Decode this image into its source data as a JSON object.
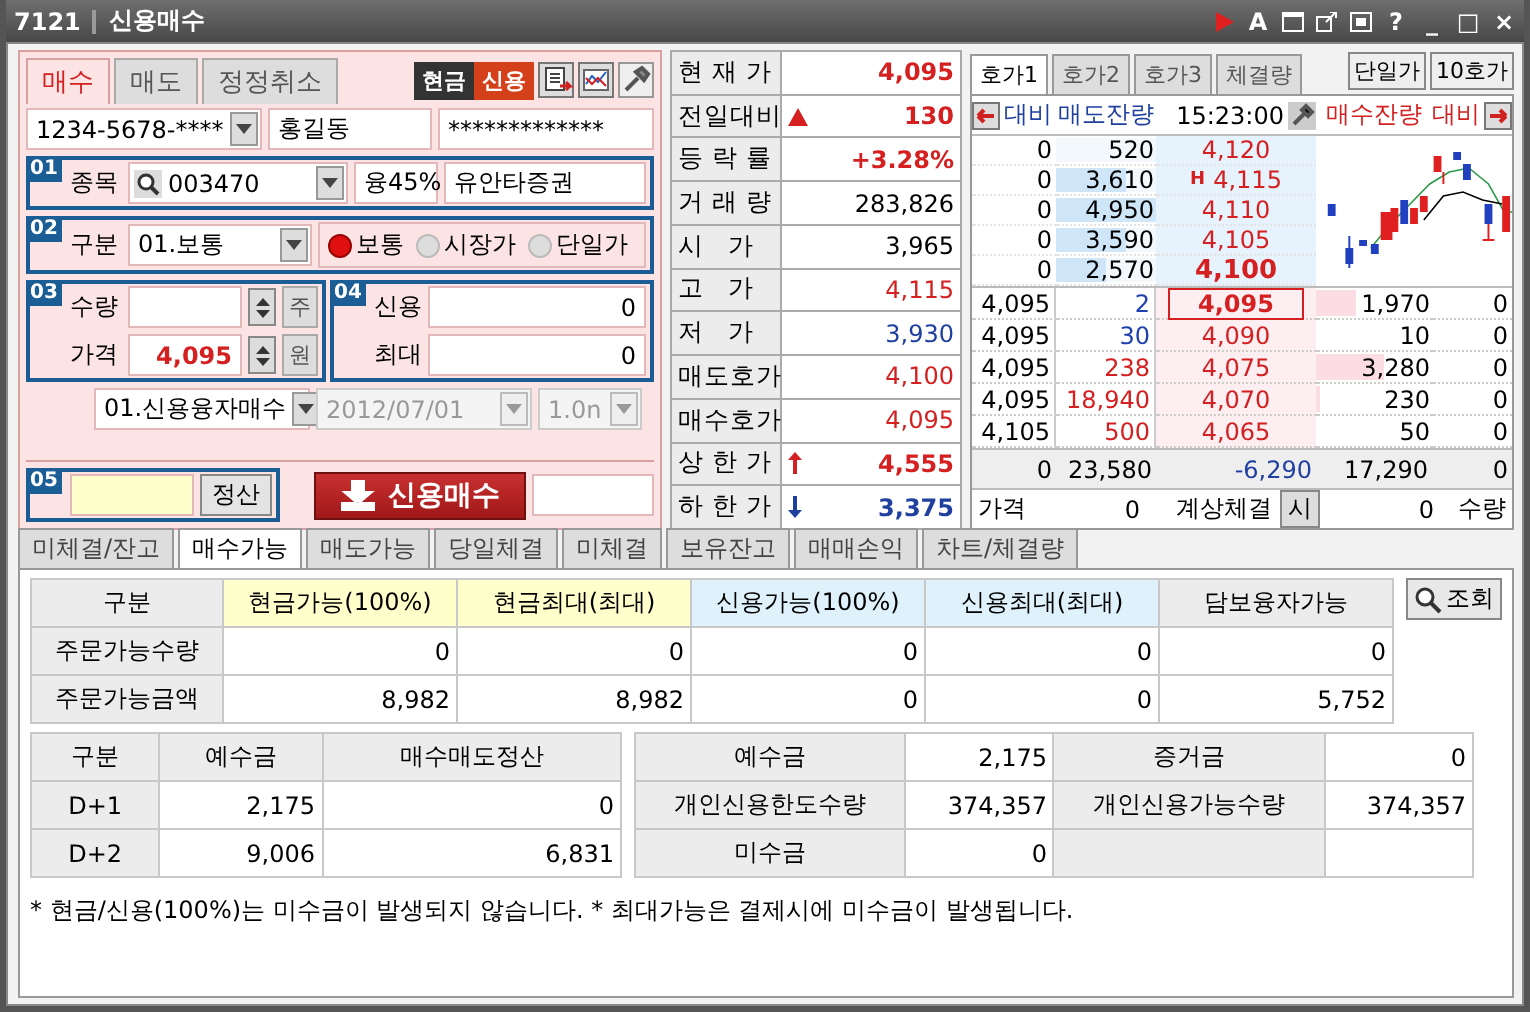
{
  "window": {
    "code": "7121",
    "title": "신용매수",
    "tool_buttons": [
      "A",
      "?"
    ],
    "controls": [
      "_",
      "□",
      "×"
    ]
  },
  "order_tabs": [
    {
      "label": "매수",
      "selected": true
    },
    {
      "label": "매도",
      "selected": false
    },
    {
      "label": "정정취소",
      "selected": false
    }
  ],
  "mode_toggle": [
    {
      "label": "현금",
      "selected": false
    },
    {
      "label": "신용",
      "selected": true
    }
  ],
  "account": {
    "number": "1234-5678-****",
    "name": "홍길동",
    "password": "*************"
  },
  "stock": {
    "badge": "01",
    "label": "종목",
    "code": "003470",
    "margin": "융45%",
    "name": "유안타증권"
  },
  "order_type": {
    "badge": "02",
    "label": "구분",
    "value": "01.보통",
    "options": [
      {
        "label": "보통",
        "selected": true
      },
      {
        "label": "시장가",
        "selected": false
      },
      {
        "label": "단일가",
        "selected": false
      }
    ]
  },
  "quantity_price": {
    "badge": "03",
    "quantity_label": "수량",
    "quantity_unit": "주",
    "price_label": "가격",
    "price": "4,095",
    "price_unit": "원"
  },
  "credit": {
    "badge": "04",
    "rows": [
      {
        "label": "신용",
        "value": "0"
      },
      {
        "label": "최대",
        "value": "0"
      }
    ]
  },
  "loan": {
    "type": "01.신용융자매수",
    "date": "2012/07/01",
    "date_disabled": true,
    "term": "1.0n",
    "term_disabled": true
  },
  "settle": {
    "badge": "05",
    "button": "정산",
    "submit": "신용매수"
  },
  "quote": [
    {
      "label": "현 재 가",
      "value": "4,095",
      "color": "#d42020",
      "bold": true
    },
    {
      "label": "전일대비",
      "value": "130",
      "color": "#d42020",
      "bold": true,
      "kind": "triangle"
    },
    {
      "label": "등 락 률",
      "value": "+3.28%",
      "color": "#d42020",
      "bold": true
    },
    {
      "label": "거 래 량",
      "value": "283,826",
      "color": "#000000",
      "bold": false
    },
    {
      "label": "시   가",
      "value": "3,965",
      "color": "#000000",
      "bold": false
    },
    {
      "label": "고   가",
      "value": "4,115",
      "color": "#d42020",
      "bold": false
    },
    {
      "label": "저   가",
      "value": "3,930",
      "color": "#2040a0",
      "bold": false
    },
    {
      "label": "매도호가",
      "value": "4,100",
      "color": "#d42020",
      "bold": false
    },
    {
      "label": "매수호가",
      "value": "4,095",
      "color": "#d42020",
      "bold": false
    },
    {
      "label": "상 한 가",
      "value": "4,555",
      "color": "#d42020",
      "bold": true,
      "kind": "up"
    },
    {
      "label": "하 한 가",
      "value": "3,375",
      "color": "#2040a0",
      "bold": true,
      "kind": "down"
    }
  ],
  "book_tabs": [
    {
      "label": "호가1",
      "selected": true
    },
    {
      "label": "호가2",
      "selected": false
    },
    {
      "label": "호가3",
      "selected": false
    },
    {
      "label": "체결량",
      "selected": false
    }
  ],
  "book_buttons": [
    "단일가",
    "10호가"
  ],
  "book_header": {
    "ask_change": "대비",
    "ask_volume": "매도잔량",
    "time": "15:23:00",
    "bid_volume": "매수잔량",
    "bid_change": "대비"
  },
  "asks": [
    {
      "change": "0",
      "volume": "520",
      "level": 0,
      "price": "4,120",
      "bold": false
    },
    {
      "change": "0",
      "volume": "3,610",
      "level": 0.7,
      "price": "4,115",
      "bold": false,
      "marker": "H"
    },
    {
      "change": "0",
      "volume": "4,950",
      "level": 1,
      "price": "4,110",
      "bold": false
    },
    {
      "change": "0",
      "volume": "3,590",
      "level": 0.7,
      "price": "4,105",
      "bold": false
    },
    {
      "change": "0",
      "volume": "2,570",
      "level": 0.5,
      "price": "4,100",
      "bold": true
    }
  ],
  "bids": [
    {
      "trade_price": "4,095",
      "trade_qty": "2",
      "color": "#2040b0",
      "price": "4,095",
      "current": true,
      "volume": "1,970",
      "level": 0.35,
      "change": "0"
    },
    {
      "trade_price": "4,095",
      "trade_qty": "30",
      "color": "#2040b0",
      "price": "4,090",
      "current": false,
      "volume": "10",
      "level": 0,
      "change": "0"
    },
    {
      "trade_price": "4,095",
      "trade_qty": "238",
      "color": "#d42020",
      "price": "4,075",
      "current": false,
      "volume": "3,280",
      "level": 0.58,
      "change": "0"
    },
    {
      "trade_price": "4,095",
      "trade_qty": "18,940",
      "color": "#d42020",
      "price": "4,070",
      "current": false,
      "volume": "230",
      "level": 0.03,
      "change": "0"
    },
    {
      "trade_price": "4,105",
      "trade_qty": "500",
      "color": "#d42020",
      "price": "4,065",
      "current": false,
      "volume": "50",
      "level": 0,
      "change": "0"
    }
  ],
  "book_totals": {
    "ask_change": "0",
    "ask_volume": "23,580",
    "diff": "-6,290",
    "bid_volume": "17,290",
    "bid_change": "0"
  },
  "book_footer": {
    "price_label": "가격",
    "price": "0",
    "auction_label": "계상체결",
    "auction_button": "시",
    "qty": "0",
    "qty_label": "수량"
  },
  "result_tabs": [
    {
      "label": "미체결/잔고",
      "selected": false
    },
    {
      "label": "매수가능",
      "selected": true
    },
    {
      "label": "매도가능",
      "selected": false
    },
    {
      "label": "당일체결",
      "selected": false
    },
    {
      "label": "미체결",
      "selected": false
    },
    {
      "label": "보유잔고",
      "selected": false
    },
    {
      "label": "매매손익",
      "selected": false
    },
    {
      "label": "차트/체결량",
      "selected": false
    }
  ],
  "availability": {
    "columns": [
      {
        "label": "구분",
        "color": "#ececec"
      },
      {
        "label": "현금가능(100%)",
        "color": "#ffffcc"
      },
      {
        "label": "현금최대(최대)",
        "color": "#ffffcc"
      },
      {
        "label": "신용가능(100%)",
        "color": "#dff2fb"
      },
      {
        "label": "신용최대(최대)",
        "color": "#dff2fb"
      },
      {
        "label": "담보융자가능",
        "color": "#ececec"
      }
    ],
    "rows": [
      {
        "label": "주문가능수량",
        "values": [
          "0",
          "0",
          "0",
          "0",
          "0"
        ]
      },
      {
        "label": "주문가능금액",
        "values": [
          "8,982",
          "8,982",
          "0",
          "0",
          "5,752"
        ]
      }
    ],
    "button": "조회"
  },
  "deposits": {
    "columns": [
      "구분",
      "예수금",
      "매수매도정산"
    ],
    "rows": [
      {
        "label": "D+1",
        "values": [
          "2,175",
          "0"
        ]
      },
      {
        "label": "D+2",
        "values": [
          "9,006",
          "6,831"
        ]
      }
    ]
  },
  "margin": {
    "rows": [
      {
        "cells": [
          {
            "label": "예수금",
            "value": "2,175"
          },
          {
            "label": "증거금",
            "value": "0"
          }
        ]
      },
      {
        "cells": [
          {
            "label": "개인신용한도수량",
            "value": "374,357"
          },
          {
            "label": "개인신용가능수량",
            "value": "374,357"
          }
        ]
      },
      {
        "cells": [
          {
            "label": "미수금",
            "value": "0"
          }
        ]
      }
    ]
  },
  "note": "* 현금/신용(100%)는 미수금이 발생되지 않습니다. * 최대가능은 결제시에 미수금이 발생됩니다."
}
